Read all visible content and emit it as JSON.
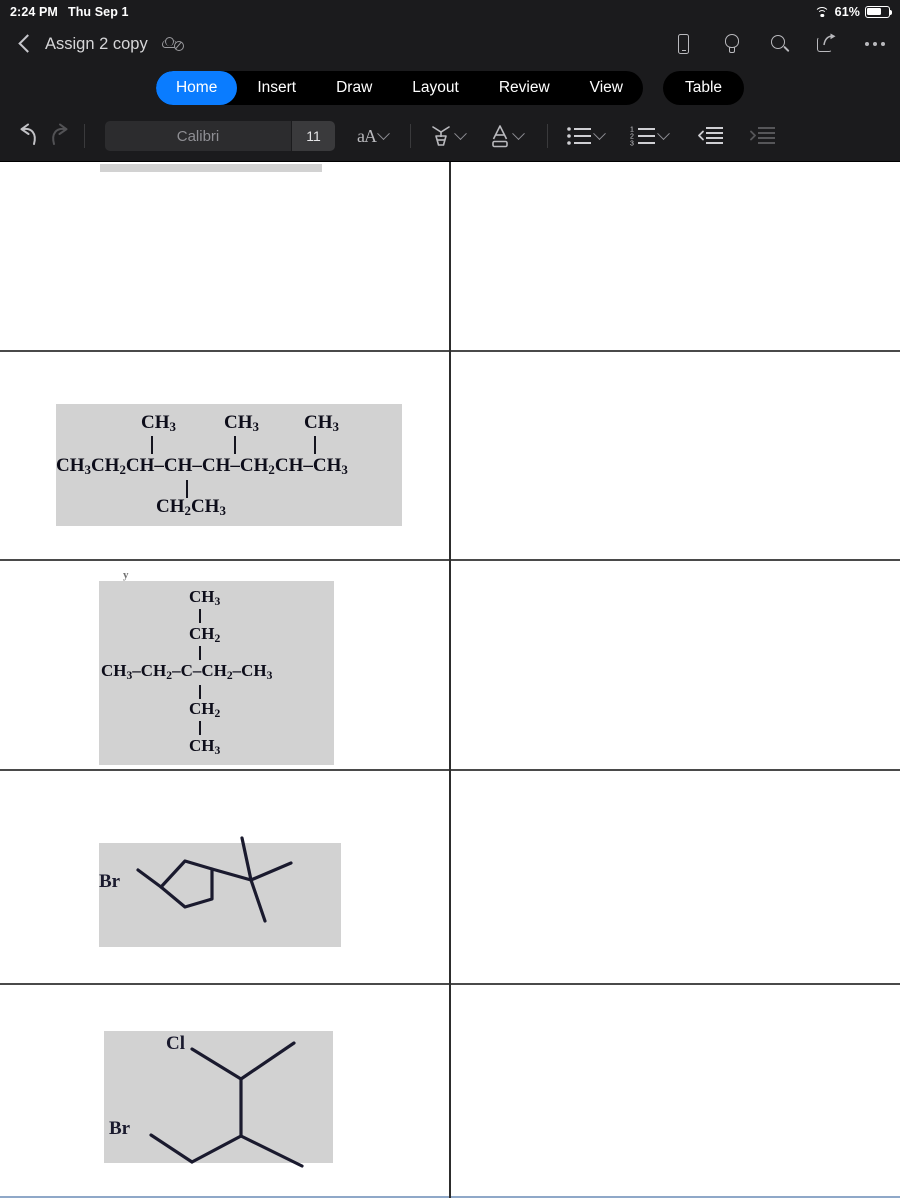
{
  "status_bar": {
    "time": "2:24 PM",
    "date": "Thu Sep 1",
    "battery_percent": "61%",
    "battery_level": 61,
    "wifi_icon": "wifi-icon",
    "battery_icon": "battery-icon"
  },
  "titlebar": {
    "back_icon": "back-chevron-icon",
    "title": "Assign 2 copy",
    "sync_icon": "cloud-offline-icon",
    "actions": [
      {
        "name": "mobile-view-icon",
        "label": "Mobile View"
      },
      {
        "name": "tell-me-icon",
        "label": "Tell Me"
      },
      {
        "name": "search-icon",
        "label": "Search"
      },
      {
        "name": "share-icon",
        "label": "Share"
      },
      {
        "name": "more-options-icon",
        "label": "More"
      }
    ]
  },
  "ribbon": {
    "tabs": [
      {
        "label": "Home",
        "active": true
      },
      {
        "label": "Insert",
        "active": false
      },
      {
        "label": "Draw",
        "active": false
      },
      {
        "label": "Layout",
        "active": false
      },
      {
        "label": "Review",
        "active": false
      },
      {
        "label": "View",
        "active": false
      }
    ],
    "context_tab": "Table",
    "active_color": "#0a7cff"
  },
  "format_toolbar": {
    "undo_icon": "undo-icon",
    "redo_icon": "redo-icon",
    "font_name": "Calibri",
    "font_size": "11",
    "font_format_label": "aA",
    "items": [
      {
        "name": "font-format-button",
        "label": "aA"
      },
      {
        "name": "highlight-color-button",
        "label": "Highlight"
      },
      {
        "name": "font-color-button",
        "label": "Font Color"
      },
      {
        "name": "bullet-list-button",
        "label": "Bullets"
      },
      {
        "name": "numbered-list-button",
        "label": "Numbering"
      },
      {
        "name": "decrease-indent-button",
        "label": "Decrease Indent"
      },
      {
        "name": "increase-indent-button",
        "label": "Increase Indent"
      }
    ]
  },
  "document": {
    "table": {
      "column_count": 2,
      "rows": [
        {
          "id": "row-partial",
          "left_cell": {
            "content_type": "image",
            "description": "partially scrolled structure image"
          },
          "right_cell": {
            "content_type": "empty",
            "text": ""
          }
        },
        {
          "id": "row-1",
          "left_cell": {
            "content_type": "image",
            "description": "condensed structural formula",
            "formula_main": "CH3CH2CH-CH-CH-CH2CH-CH3",
            "substituents_top": [
              "CH3",
              "CH3",
              "CH3"
            ],
            "substituents_bottom": [
              "CH2CH3"
            ]
          },
          "right_cell": {
            "content_type": "empty",
            "text": ""
          }
        },
        {
          "id": "row-2",
          "left_cell": {
            "content_type": "image",
            "description": "condensed structural formula with quaternary carbon",
            "formula_main": "CH3-CH2-C-CH2-CH3",
            "substituents_top": [
              "CH3",
              "CH2"
            ],
            "substituents_bottom": [
              "CH2",
              "CH3"
            ]
          },
          "right_cell": {
            "content_type": "empty",
            "text": ""
          }
        },
        {
          "id": "row-3",
          "left_cell": {
            "content_type": "image",
            "description": "skeletal structure: bromo-substituted cyclopentane with tert-butyl group",
            "labels": [
              "Br"
            ]
          },
          "right_cell": {
            "content_type": "empty",
            "text": ""
          }
        },
        {
          "id": "row-4",
          "left_cell": {
            "content_type": "image",
            "description": "skeletal structure with chloro and bromo substituents",
            "labels": [
              "Cl",
              "Br"
            ]
          },
          "right_cell": {
            "content_type": "empty",
            "text": ""
          }
        }
      ]
    },
    "colors": {
      "image_background": "#d2d2d2",
      "table_border": "#4a4a4a",
      "table_bottom_border": "#8fa8c8",
      "bond_color": "#14141e"
    }
  },
  "structure_1": {
    "top_labels": [
      "CH3",
      "CH3",
      "CH3"
    ],
    "chain_text": "CH3CH2CH-CH-CH-CH2CH-CH3",
    "bottom_label": "CH2CH3"
  },
  "structure_2": {
    "top_labels": [
      "CH3",
      "CH2"
    ],
    "chain_text": "CH3-CH2-C-CH2-CH3",
    "bottom_labels": [
      "CH2",
      "CH3"
    ]
  },
  "structure_3": {
    "labels": [
      "Br"
    ]
  },
  "structure_4": {
    "labels": [
      "Cl",
      "Br"
    ]
  }
}
